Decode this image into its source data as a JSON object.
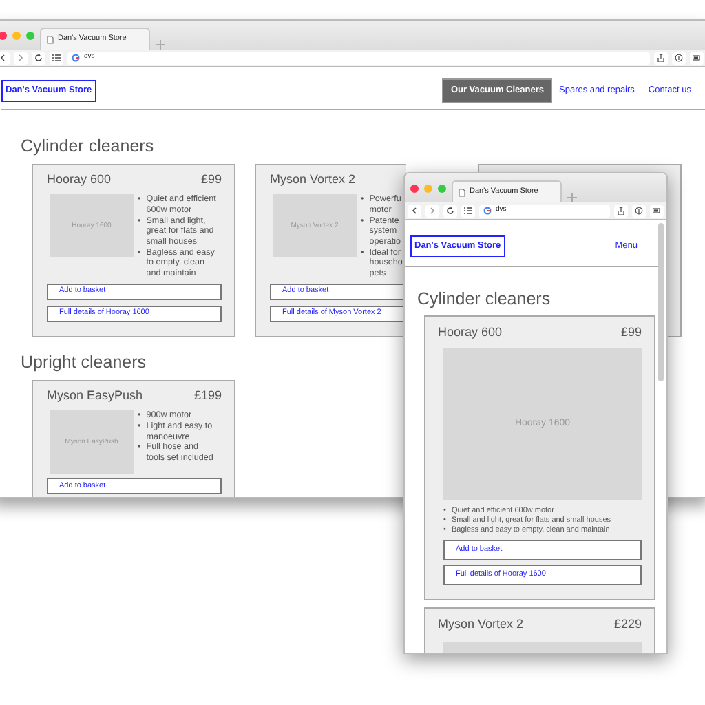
{
  "desktop_window": {
    "tab_title": "Dan's Vacuum Store",
    "address": "dvs",
    "logo": "Dan's Vacuum Store",
    "nav": [
      {
        "label": "Our Vacuum Cleaners",
        "selected": true
      },
      {
        "label": "Spares and repairs",
        "selected": false
      },
      {
        "label": "Contact us",
        "selected": false
      }
    ],
    "sections": [
      {
        "heading": "Cylinder cleaners",
        "products": [
          {
            "kind": "full",
            "name": "Hooray 600",
            "price": "£99",
            "image_label": "Hooray 1600",
            "features": [
              {
                "marker": "•",
                "lines": [
                  "Quiet and efficient",
                  "600w motor"
                ]
              },
              {
                "marker": "•",
                "lines": [
                  "Small and light,",
                  "great for flats and",
                  "small houses"
                ]
              },
              {
                "marker": "•",
                "lines": [
                  "Bagless and easy",
                  "to empty, clean",
                  "and maintain"
                ]
              }
            ],
            "buttons": [
              "Add to basket",
              "Full details of Hooray 1600"
            ]
          },
          {
            "kind": "covered",
            "name": "Myson Vortex 2",
            "image_label": "Myson Vortex 2",
            "features": [
              {
                "marker": "•",
                "lines": [
                  "Powerfu",
                  "motor"
                ]
              },
              {
                "marker": "•",
                "lines": [
                  "Patente",
                  "system",
                  "operatio"
                ]
              },
              {
                "marker": "•",
                "lines": [
                  "Ideal for",
                  "househo",
                  "pets"
                ]
              }
            ],
            "buttons": [
              "Add to basket",
              "Full details of Myson Vortex 2"
            ]
          },
          {
            "kind": "hidden"
          }
        ]
      },
      {
        "heading": "Upright cleaners",
        "products": [
          {
            "kind": "full",
            "name": "Myson EasyPush",
            "price": "£199",
            "image_label": "Myson EasyPush",
            "features": [
              {
                "marker": "•",
                "lines": [
                  "900w motor"
                ]
              },
              {
                "marker": "•",
                "lines": [
                  "Light and easy to",
                  "manoeuvre"
                ]
              },
              {
                "marker": "•",
                "lines": [
                  "Full hose and",
                  "tools set included"
                ]
              }
            ],
            "buttons": [
              "Add to basket"
            ]
          }
        ]
      }
    ]
  },
  "mobile_window": {
    "tab_title": "Dan's Vacuum Store",
    "address": "dvs",
    "logo": "Dan's Vacuum Store",
    "menu": "Menu",
    "heading": "Cylinder cleaners",
    "products": [
      {
        "name": "Hooray 600",
        "price": "£99",
        "image_label": "Hooray 1600",
        "features": [
          {
            "marker": "•",
            "text": "Quiet and efficient 600w motor"
          },
          {
            "marker": "•",
            "text": "Small and light, great for flats and small houses"
          },
          {
            "marker": "•",
            "text": "Bagless and easy to empty, clean and maintain"
          }
        ],
        "buttons": [
          "Add to basket",
          "Full details of Hooray 1600"
        ]
      },
      {
        "name": "Myson Vortex 2",
        "price": "£229"
      }
    ]
  }
}
